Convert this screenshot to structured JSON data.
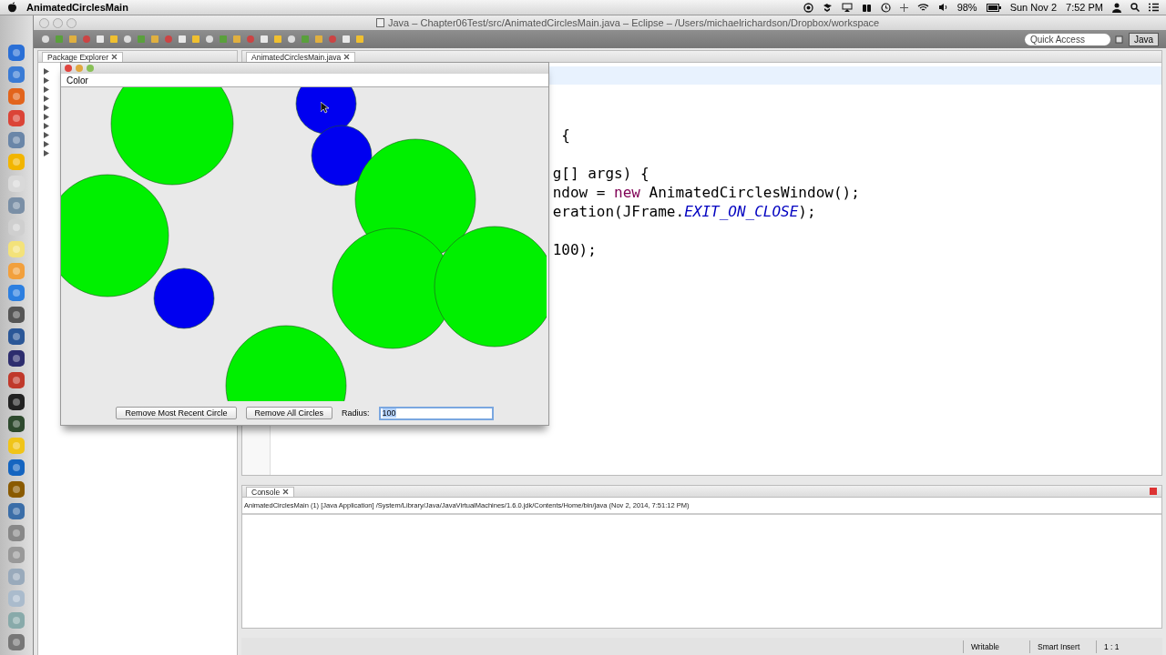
{
  "menu_bar": {
    "app_name": "AnimatedCirclesMain",
    "battery": "98%",
    "date": "Sun Nov 2",
    "time": "7:52 PM"
  },
  "eclipse": {
    "title": "Java – Chapter06Test/src/AnimatedCirclesMain.java – Eclipse – /Users/michaelrichardson/Dropbox/workspace",
    "quick_access": {
      "placeholder": "Quick Access"
    },
    "perspective": {
      "label": "Java",
      "selected": true
    }
  },
  "package_explorer": {
    "tab": "Package Explorer"
  },
  "editor": {
    "tab": "AnimatedCirclesMain.java",
    "lines": [
      [
        {
          "kind": "plain",
          "text": "{"
        }
      ],
      [
        {
          "kind": "plain",
          "text": "g[] args) {"
        }
      ],
      [
        {
          "kind": "plain",
          "text": "ndow = "
        },
        {
          "kind": "keyword",
          "text": "new"
        },
        {
          "kind": "plain",
          "text": " AnimatedCirclesWindow();"
        }
      ],
      [
        {
          "kind": "plain",
          "text": "eration(JFrame."
        },
        {
          "kind": "constant",
          "text": "EXIT_ON_CLOSE"
        },
        {
          "kind": "plain",
          "text": ");"
        }
      ],
      [
        {
          "kind": "plain",
          "text": "100);"
        }
      ]
    ]
  },
  "console": {
    "tab": "Console",
    "launch": "AnimatedCirclesMain (1) [Java Application] /System/Library/Java/JavaVirtualMachines/1.6.0.jdk/Contents/Home/bin/java (Nov 2, 2014, 7:51:12 PM)"
  },
  "status_bar": [
    "Writable",
    "Smart Insert",
    "1 : 1"
  ],
  "swing_window": {
    "menu": [
      "Color"
    ],
    "circles": [
      {
        "color": "#00f000"
      },
      {
        "color": "#0000f0"
      },
      {
        "color": "#0000f0"
      },
      {
        "color": "#00f000"
      },
      {
        "color": "#00f000"
      },
      {
        "color": "#0000f0"
      },
      {
        "color": "#00f000"
      },
      {
        "color": "#00f000"
      },
      {
        "color": "#00f000"
      }
    ],
    "buttons": [
      "Remove Most Recent Circle",
      "Remove All Circles"
    ],
    "radius": {
      "label": "Radius:",
      "value": "100"
    }
  }
}
